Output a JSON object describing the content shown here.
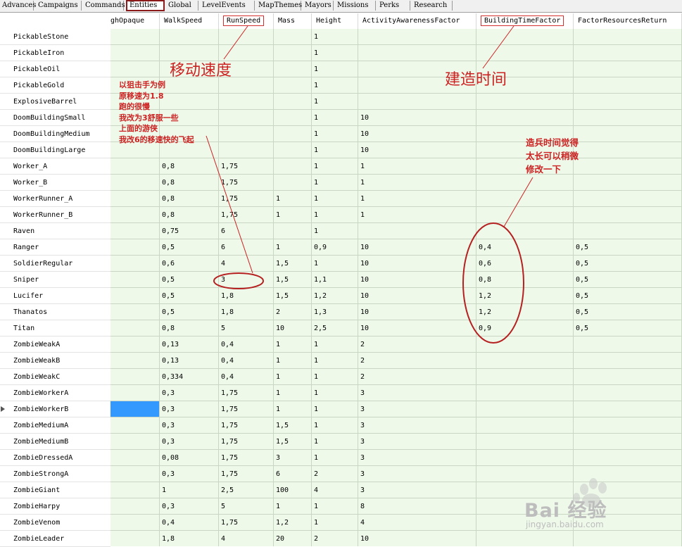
{
  "tabs": [
    "Advances",
    "Campaigns",
    "Commands",
    "Entities",
    "Global",
    "LevelEvents",
    "MapThemes",
    "Mayors",
    "Missions",
    "Perks",
    "Research"
  ],
  "active_tab": "Entities",
  "columns": [
    "ghOpaque",
    "WalkSpeed",
    "RunSpeed",
    "Mass",
    "Height",
    "ActivityAwarenessFactor",
    "BuildingTimeFactor",
    "FactorResourcesReturn"
  ],
  "highlighted_columns": [
    "RunSpeed",
    "BuildingTimeFactor"
  ],
  "current_row": "ZombieWorkerB",
  "rows": [
    {
      "name": "PickableStone",
      "cells": [
        "",
        "",
        "",
        "",
        "1",
        "",
        "",
        ""
      ]
    },
    {
      "name": "PickableIron",
      "cells": [
        "",
        "",
        "",
        "",
        "1",
        "",
        "",
        ""
      ]
    },
    {
      "name": "PickableOil",
      "cells": [
        "",
        "",
        "",
        "",
        "1",
        "",
        "",
        ""
      ]
    },
    {
      "name": "PickableGold",
      "cells": [
        "",
        "",
        "",
        "",
        "1",
        "",
        "",
        ""
      ]
    },
    {
      "name": "ExplosiveBarrel",
      "cells": [
        "",
        "",
        "",
        "",
        "1",
        "",
        "",
        ""
      ]
    },
    {
      "name": "DoomBuildingSmall",
      "cells": [
        "",
        "",
        "",
        "",
        "1",
        "10",
        "",
        ""
      ]
    },
    {
      "name": "DoomBuildingMedium",
      "cells": [
        "",
        "",
        "",
        "",
        "1",
        "10",
        "",
        ""
      ]
    },
    {
      "name": "DoomBuildingLarge",
      "cells": [
        "",
        "",
        "",
        "",
        "1",
        "10",
        "",
        ""
      ]
    },
    {
      "name": "Worker_A",
      "cells": [
        "",
        "0,8",
        "1,75",
        "",
        "1",
        "1",
        "",
        ""
      ]
    },
    {
      "name": "Worker_B",
      "cells": [
        "",
        "0,8",
        "1,75",
        "",
        "1",
        "1",
        "",
        ""
      ]
    },
    {
      "name": "WorkerRunner_A",
      "cells": [
        "",
        "0,8",
        "1,75",
        "1",
        "1",
        "1",
        "",
        ""
      ]
    },
    {
      "name": "WorkerRunner_B",
      "cells": [
        "",
        "0,8",
        "1,75",
        "1",
        "1",
        "1",
        "",
        ""
      ]
    },
    {
      "name": "Raven",
      "cells": [
        "",
        "0,75",
        "6",
        "",
        "1",
        "",
        "",
        ""
      ]
    },
    {
      "name": "Ranger",
      "cells": [
        "",
        "0,5",
        "6",
        "1",
        "0,9",
        "10",
        "0,4",
        "0,5"
      ]
    },
    {
      "name": "SoldierRegular",
      "cells": [
        "",
        "0,6",
        "4",
        "1,5",
        "1",
        "10",
        "0,6",
        "0,5"
      ]
    },
    {
      "name": "Sniper",
      "cells": [
        "",
        "0,5",
        "3",
        "1,5",
        "1,1",
        "10",
        "0,8",
        "0,5"
      ]
    },
    {
      "name": "Lucifer",
      "cells": [
        "",
        "0,5",
        "1,8",
        "1,5",
        "1,2",
        "10",
        "1,2",
        "0,5"
      ]
    },
    {
      "name": "Thanatos",
      "cells": [
        "",
        "0,5",
        "1,8",
        "2",
        "1,3",
        "10",
        "1,2",
        "0,5"
      ]
    },
    {
      "name": "Titan",
      "cells": [
        "",
        "0,8",
        "5",
        "10",
        "2,5",
        "10",
        "0,9",
        "0,5"
      ]
    },
    {
      "name": "ZombieWeakA",
      "cells": [
        "",
        "0,13",
        "0,4",
        "1",
        "1",
        "2",
        "",
        ""
      ]
    },
    {
      "name": "ZombieWeakB",
      "cells": [
        "",
        "0,13",
        "0,4",
        "1",
        "1",
        "2",
        "",
        ""
      ]
    },
    {
      "name": "ZombieWeakC",
      "cells": [
        "",
        "0,334",
        "0,4",
        "1",
        "1",
        "2",
        "",
        ""
      ]
    },
    {
      "name": "ZombieWorkerA",
      "cells": [
        "",
        "0,3",
        "1,75",
        "1",
        "1",
        "3",
        "",
        ""
      ]
    },
    {
      "name": "ZombieWorkerB",
      "cells": [
        "",
        "0,3",
        "1,75",
        "1",
        "1",
        "3",
        "",
        ""
      ]
    },
    {
      "name": "ZombieMediumA",
      "cells": [
        "",
        "0,3",
        "1,75",
        "1,5",
        "1",
        "3",
        "",
        ""
      ]
    },
    {
      "name": "ZombieMediumB",
      "cells": [
        "",
        "0,3",
        "1,75",
        "1,5",
        "1",
        "3",
        "",
        ""
      ]
    },
    {
      "name": "ZombieDressedA",
      "cells": [
        "",
        "0,08",
        "1,75",
        "3",
        "1",
        "3",
        "",
        ""
      ]
    },
    {
      "name": "ZombieStrongA",
      "cells": [
        "",
        "0,3",
        "1,75",
        "6",
        "2",
        "3",
        "",
        ""
      ]
    },
    {
      "name": "ZombieGiant",
      "cells": [
        "",
        "1",
        "2,5",
        "100",
        "4",
        "3",
        "",
        ""
      ]
    },
    {
      "name": "ZombieHarpy",
      "cells": [
        "",
        "0,3",
        "5",
        "1",
        "1",
        "8",
        "",
        ""
      ]
    },
    {
      "name": "ZombieVenom",
      "cells": [
        "",
        "0,4",
        "1,75",
        "1,2",
        "1",
        "4",
        "",
        ""
      ]
    },
    {
      "name": "ZombieLeader",
      "cells": [
        "",
        "1,8",
        "4",
        "20",
        "2",
        "10",
        "",
        ""
      ]
    }
  ],
  "annotations": {
    "move_speed": "移动速度",
    "build_time": "建造时间",
    "sniper_note": "以狙击手为例\n原移速为1.8\n跑的很慢\n我改为3舒服一些\n上面的游侠\n我改6的移速快的飞起",
    "build_note": "造兵时间觉得\n太长可以稍微\n修改一下"
  },
  "watermark": {
    "text": "Bai 经验",
    "url": "jingyan.baidu.com"
  },
  "colors": {
    "annotation": "#cc2222",
    "grid_bg": "#eef9ea",
    "selection": "#3399ff",
    "active_tab_border": "#8b1a1a"
  }
}
